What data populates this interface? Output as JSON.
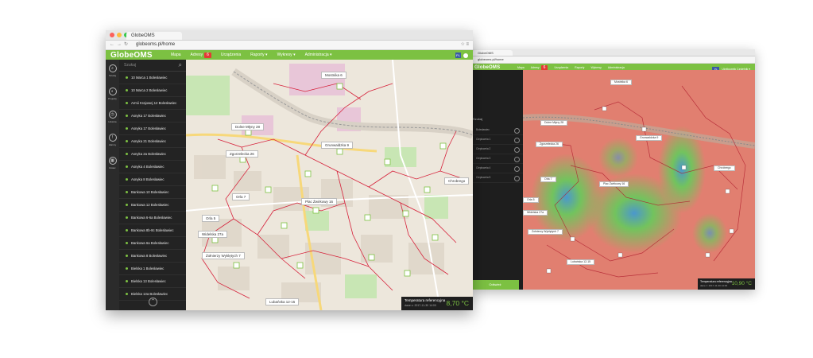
{
  "front": {
    "tab_title": "GlobeOMS",
    "url": "globeoms.pl/home",
    "brand": "GlobeOMS",
    "nav": [
      {
        "label": "Mapa"
      },
      {
        "label": "Adresy",
        "badge": "6"
      },
      {
        "label": "Urządzenia"
      },
      {
        "label": "Raporty ▾"
      },
      {
        "label": "Wykresy ▾"
      },
      {
        "label": "Administracja ▾"
      }
    ],
    "user_initials": "PL",
    "rail": [
      {
        "icon": "search-icon",
        "label": "Szukaj"
      },
      {
        "icon": "projects-icon",
        "label": "Projekty"
      },
      {
        "icon": "history-icon",
        "label": "Historia"
      },
      {
        "icon": "alarms-icon",
        "label": "Alarmy"
      },
      {
        "icon": "grid-icon",
        "label": "Ustaw."
      }
    ],
    "search_placeholder": "Szukaj",
    "addresses": [
      "10 Marca 1 Bolesławiec",
      "10 Marca 2 Bolesławiec",
      "Armii Krajowej 12 Bolesławiec",
      "Asnyka 17 Bolesławiec",
      "Asnyka 17 Bolesławiec",
      "Asnyka 21 Bolesławiec",
      "Asnyka 2a Bolesławiec",
      "Asnyka 4 Bolesławiec",
      "Asnyka 8 Bolesławiec",
      "Bankowa 10 Bolesławiec",
      "Bankowa 12 Bolesławiec",
      "Bankowa 6-6a Bolesławiec",
      "Bankowa 8b-8c Bolesławiec",
      "Bankowa 6a Bolesławiec",
      "Bankowa 8 Bolesławiec",
      "Bielska 1 Bolesławiec",
      "Bielska 13 Bolesławiec",
      "Bielska 13a Bolesławiec"
    ],
    "map_labels": [
      "Mostnika 6",
      "Dolne Młyny 28",
      "Grunwaldzka 9",
      "Zgorzelecka 26",
      "Orla 7",
      "Plac Żwirkowy 16",
      "Orla 5",
      "Widelska 27a",
      "Żołnierzy Wyklętych 7",
      "Lubańska 12-15",
      "Chrobrego"
    ],
    "temp_label": "Temperatura referencyjna",
    "temp_date": "dane z: 2017-11-30 14:00",
    "temp_value": "8,70 °C"
  },
  "back": {
    "tab_title": "GlobeOMS",
    "url": "globeoms.pl/home",
    "brand": "GlobeOMS",
    "nav": [
      "Mapa",
      "Adresy",
      "Urządzenia",
      "Raporty",
      "Wykresy",
      "Administracja"
    ],
    "badge": "6",
    "user": "Użytkownik Czytelnik ▾",
    "search_label": "Szukaj",
    "rows": [
      "Bolesławiec",
      "Ciepłownia 1",
      "Ciepłownia 2",
      "Ciepłownia 3",
      "Ciepłownia 4",
      "Ciepłownia 5"
    ],
    "button": "Odśwież",
    "map_labels": [
      "Mostnika 6",
      "Dolne Młyny 28",
      "Grunwaldzka 9",
      "Zgorzelecka 26",
      "Orla 7",
      "Plac Żwirkowy 16",
      "Orla 5",
      "Widelska 27a",
      "Żołnierzy Wyklętych 7",
      "Lubańska 12-15",
      "Chrobrego"
    ],
    "temp_label": "Temperatura referencyjna",
    "temp_date": "dane z: 2017-11-30 14:00",
    "temp_value": "10,90 °C"
  },
  "colors": {
    "brand_green": "#7cc142",
    "route_red": "#d6223b",
    "sidebar": "#232323"
  }
}
